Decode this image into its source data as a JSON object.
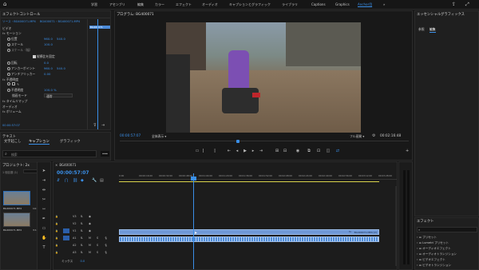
{
  "menu": {
    "tabs": [
      "学習",
      "アセンブリ",
      "編集",
      "カラー",
      "エフェクト",
      "オーディオ",
      "キャプションとグラフィック",
      "ライブラリ",
      "Captions",
      "Graphics",
      "Anchor用",
      "»"
    ],
    "active_index": 10
  },
  "effect_controls": {
    "title": "エフェクトコントロール",
    "source_label": "ソース・BG400071.MP4",
    "clip_label": "BG400071・BG400071.MP4",
    "mini_clip": "BG400071",
    "sections": {
      "video": "ビデオ",
      "motion": "モーション",
      "position": "位置",
      "scale": "スケール",
      "scale_width": "スケール（幅）",
      "uniform_scale": "縦横比を固定",
      "rotation": "回転",
      "anchor": "アンカーポイント",
      "antiflicker": "アンチフリッカー",
      "opacity_group": "不透明度",
      "opacity": "不透明度",
      "blend_mode": "描画モード",
      "blend_value": "通常",
      "time_remap": "タイムリマップ",
      "audio": "オーディオ",
      "volume": "ボリューム"
    },
    "values": {
      "pos_x": "960.0",
      "pos_y": "540.0",
      "scale": "100.0",
      "rotation": "0.0",
      "anchor_x": "960.0",
      "anchor_y": "540.0",
      "antiflicker": "0.00",
      "opacity": "100.0 %"
    },
    "timecode": "00:00:57:07"
  },
  "captions_panel": {
    "tabs": [
      "テキスト",
      "文字起こし",
      "キャプション",
      "グラフィック"
    ],
    "active_index": 2,
    "search_placeholder": "検索",
    "more": "•••"
  },
  "project": {
    "title": "プロジェクト: 2x",
    "bin_label": "1 個目選 (1)",
    "clips": [
      {
        "name": "BG400071.MP4",
        "dur": "14:27"
      },
      {
        "name": "BG400071.MP4",
        "dur": "3:16"
      }
    ]
  },
  "program": {
    "title": "プログラム: BG400071",
    "timecode": "00:00:57:07",
    "fit": "全体表示",
    "quality": "フル画質",
    "duration": "00:02:16:48"
  },
  "timeline": {
    "sequence": "BG400071",
    "timecode": "00:00:57:07",
    "ruler": [
      "0:00",
      "00:00:16:00",
      "00:00:32:00",
      "00:00:48:00",
      "00:01:04:00",
      "00:01:20:00",
      "00:01:36:00",
      "00:01:52:00",
      "00:02:08:00",
      "00:02:24:00",
      "00:02:40:00",
      "00:02:56:00",
      "00:03:12:00",
      "00:03:28:00"
    ],
    "tracks": [
      {
        "label": "V3",
        "kind": "video"
      },
      {
        "label": "V2",
        "kind": "video"
      },
      {
        "label": "V1",
        "kind": "video"
      },
      {
        "label": "A1",
        "kind": "audio"
      },
      {
        "label": "A2",
        "kind": "audio"
      },
      {
        "label": "A3",
        "kind": "audio"
      }
    ],
    "mix_label": "ミックス",
    "mix_value": "0.0",
    "clip_label": "BG400071.MP4 [V]",
    "playhead_fraction": 0.27
  },
  "essential_graphics": {
    "title": "エッセンシャルグラフィックス",
    "tabs": [
      "参照",
      "編集"
    ],
    "active_index": 1
  },
  "effects": {
    "title": "エフェクト",
    "items": [
      "プリセット",
      "Lumetri プリセット",
      "オーディオエフェクト",
      "オーディオトランジション",
      "ビデオエフェクト",
      "ビデオトランジション"
    ]
  },
  "colors": {
    "accent": "#3a8fe8",
    "clip_video": "#6f98d6",
    "clip_audio": "#4c8bd9",
    "panel": "#1f1f1f",
    "workarea": "#d8d24a"
  }
}
